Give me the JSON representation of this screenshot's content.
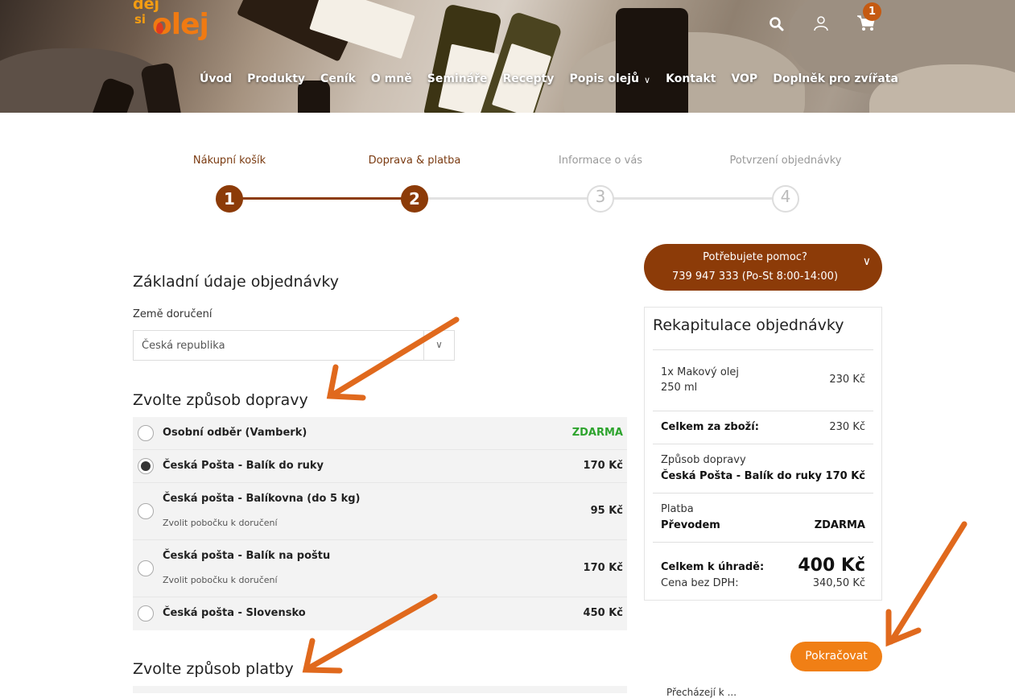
{
  "header": {
    "logo_text": [
      "dej",
      "si",
      "olej"
    ],
    "cart_count": "1",
    "nav": [
      "Úvod",
      "Produkty",
      "Ceník",
      "O mně",
      "Semináře",
      "Recepty",
      "Popis olejů",
      "Kontakt",
      "VOP",
      "Doplněk pro zvířata"
    ]
  },
  "steps": [
    {
      "label": "Nákupní košík",
      "num": "1",
      "state": "done"
    },
    {
      "label": "Doprava & platba",
      "num": "2",
      "state": "current"
    },
    {
      "label": "Informace o vás",
      "num": "3",
      "state": "todo"
    },
    {
      "label": "Potvrzení objednávky",
      "num": "4",
      "state": "todo"
    }
  ],
  "basic": {
    "title": "Základní údaje objednávky",
    "country_label": "Země doručení",
    "country_value": "Česká republika"
  },
  "shipping": {
    "title": "Zvolte způsob dopravy",
    "options": [
      {
        "name": "Osobní odběr (Vamberk)",
        "sub": "",
        "price": "ZDARMA",
        "selected": false
      },
      {
        "name": "Česká Pošta - Balík do ruky",
        "sub": "",
        "price": "170 Kč",
        "selected": true
      },
      {
        "name": "Česká pošta - Balíkovna (do 5 kg)",
        "sub": "Zvolit pobočku k doručení",
        "price": "95 Kč",
        "selected": false
      },
      {
        "name": "Česká pošta - Balík na poštu",
        "sub": "Zvolit pobočku k doručení",
        "price": "170 Kč",
        "selected": false
      },
      {
        "name": "Česká pošta - Slovensko",
        "sub": "",
        "price": "450 Kč",
        "selected": false
      }
    ]
  },
  "payment": {
    "title": "Zvolte způsob platby"
  },
  "help": {
    "line1": "Potřebujete pomoc?",
    "line2": "739 947 333 (Po-St 8:00-14:00)"
  },
  "recap": {
    "title": "Rekapitulace objednávky",
    "item_line1": "1x Makový olej",
    "item_line2": "250 ml",
    "item_price": "230 Kč",
    "goods_total_label": "Celkem za zboží:",
    "goods_total": "230 Kč",
    "shipping_label": "Způsob dopravy",
    "shipping_name": "Česká Pošta - Balík do ruky",
    "shipping_price": "170 Kč",
    "payment_label": "Platba",
    "payment_name": "Převodem",
    "payment_price": "ZDARMA",
    "total_label": "Celkem k úhradě:",
    "total": "400 Kč",
    "net_label": "Cena bez DPH:",
    "net": "340,50 Kč"
  },
  "continue_label": "Pokračovat",
  "bottom_cut_text": "Přecházejí k ...",
  "colors": {
    "brand": "#8c3b08",
    "accent": "#f07f15",
    "free": "#2ea42e"
  }
}
